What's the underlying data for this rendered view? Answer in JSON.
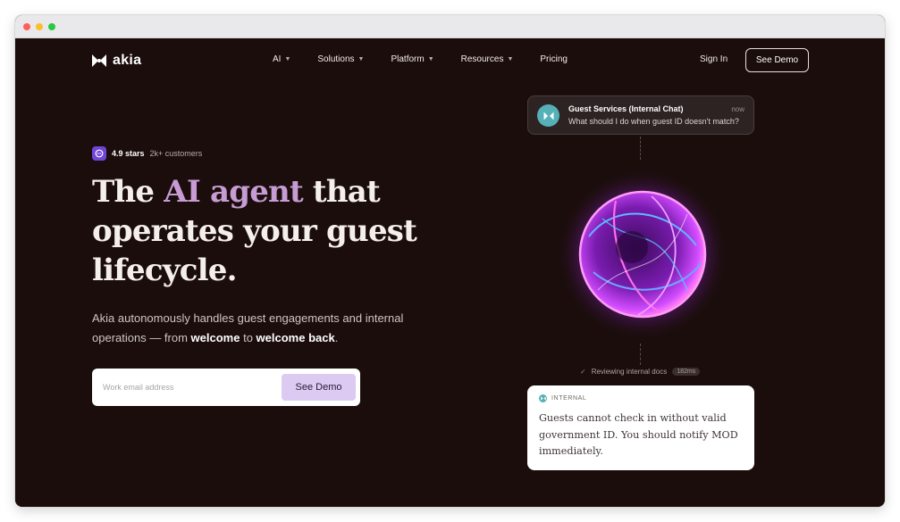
{
  "browser": {
    "dots": [
      {
        "name": "close",
        "color": "#ff5f57"
      },
      {
        "name": "minimize",
        "color": "#febc2e"
      },
      {
        "name": "zoom",
        "color": "#28c840"
      }
    ]
  },
  "brand": {
    "name": "akia",
    "icon": "bowtie-logo-icon"
  },
  "nav": {
    "items": [
      {
        "label": "AI",
        "dropdown": true
      },
      {
        "label": "Solutions",
        "dropdown": true
      },
      {
        "label": "Platform",
        "dropdown": true
      },
      {
        "label": "Resources",
        "dropdown": true
      },
      {
        "label": "Pricing",
        "dropdown": false
      }
    ],
    "sign_in": "Sign In",
    "see_demo": "See Demo"
  },
  "hero": {
    "rating": {
      "stars": "4.9 stars",
      "customers": "2k+ customers",
      "icon": "chat-bubble-icon"
    },
    "headline": {
      "before": "The ",
      "accent": "AI agent",
      "after": " that operates your guest lifecycle."
    },
    "subcopy": {
      "part1": "Akia autonomously handles guest engagements and internal operations — from ",
      "bold1": "welcome",
      "part2": " to ",
      "bold2": "welcome back",
      "part3": "."
    },
    "form": {
      "placeholder": "Work email address",
      "button": "See Demo"
    }
  },
  "demo": {
    "chat": {
      "title": "Guest Services (Internal Chat)",
      "message": "What should I do when guest ID doesn't match?",
      "time": "now"
    },
    "status": {
      "text": "Reviewing internal docs",
      "duration": "182ms"
    },
    "answer": {
      "label": "INTERNAL",
      "text": "Guests cannot check in without valid government ID. You should notify MOD immediately."
    }
  },
  "colors": {
    "background": "#1a0d0b",
    "accent": "#c79bd3",
    "button_fill": "#dccaf2",
    "teal": "#55b0b7",
    "purple_badge": "#7046d8"
  }
}
